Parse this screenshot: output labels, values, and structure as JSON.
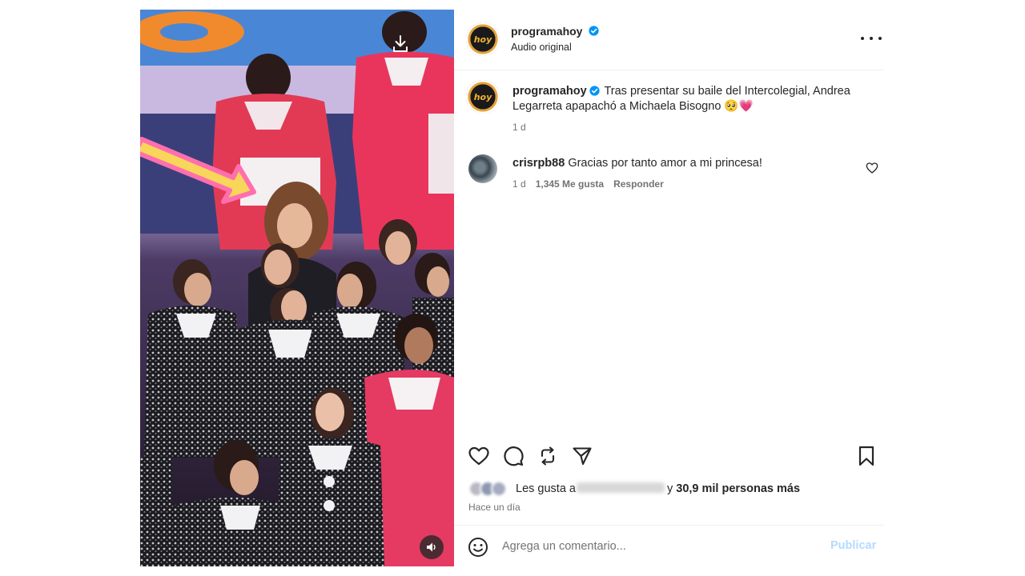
{
  "post": {
    "username": "programahoy",
    "avatar_text": "hoy",
    "audio_label": "Audio original",
    "caption": {
      "username": "programahoy",
      "text": "Tras presentar su baile del Intercolegial, Andrea Legarreta apapachó a Michaela Bisogno",
      "emojis": "🥺💗",
      "time": "1 d"
    },
    "comments": [
      {
        "username": "crisrpb88",
        "text": "Gracias por tanto amor a mi princesa!",
        "time": "1 d",
        "likes": "1,345 Me gusta",
        "reply_label": "Responder"
      }
    ],
    "likes": {
      "prefix": "Les gusta a",
      "suffix": "y",
      "count": "30,9 mil personas más"
    },
    "posted_ago": "Hace un día",
    "comment_box": {
      "placeholder": "Agrega un comentario...",
      "publish_label": "Publicar"
    }
  },
  "colors": {
    "verified": "#0095f6",
    "publish_disabled": "#b3dbff",
    "arrow": "#f7d65a",
    "arrow_outline": "#ff6fae"
  },
  "icons": [
    "download-icon",
    "volume-icon",
    "more-options-icon",
    "verified-badge-icon",
    "heart-icon",
    "comment-icon",
    "repost-icon",
    "share-icon",
    "bookmark-icon",
    "emoji-icon"
  ]
}
